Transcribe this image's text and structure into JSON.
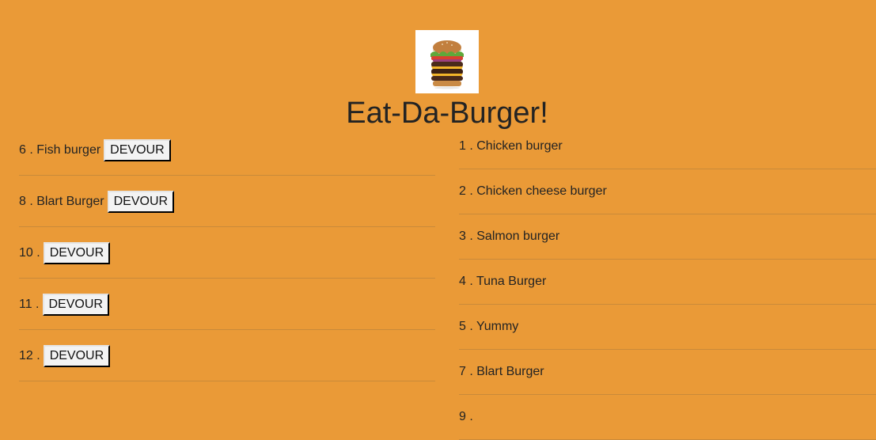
{
  "header": {
    "title": "Eat-Da-Burger!",
    "logo_icon": "burger-icon"
  },
  "left_list": {
    "items": [
      {
        "num": "6 .",
        "name": "Fish burger",
        "button": "DEVOUR"
      },
      {
        "num": "8 .",
        "name": "Blart Burger",
        "button": "DEVOUR"
      },
      {
        "num": "10 .",
        "name": "",
        "button": "DEVOUR"
      },
      {
        "num": "11 .",
        "name": "",
        "button": "DEVOUR"
      },
      {
        "num": "12 .",
        "name": "",
        "button": "DEVOUR"
      }
    ]
  },
  "right_list": {
    "items": [
      {
        "num": "1 .",
        "name": "Chicken burger"
      },
      {
        "num": "2 .",
        "name": "Chicken cheese burger"
      },
      {
        "num": "3 .",
        "name": "Salmon burger"
      },
      {
        "num": "4 .",
        "name": "Tuna Burger"
      },
      {
        "num": "5 .",
        "name": "Yummy"
      },
      {
        "num": "7 .",
        "name": "Blart Burger"
      },
      {
        "num": "9 .",
        "name": ""
      }
    ]
  },
  "colors": {
    "background": "#ea9a37",
    "text": "#232323"
  }
}
